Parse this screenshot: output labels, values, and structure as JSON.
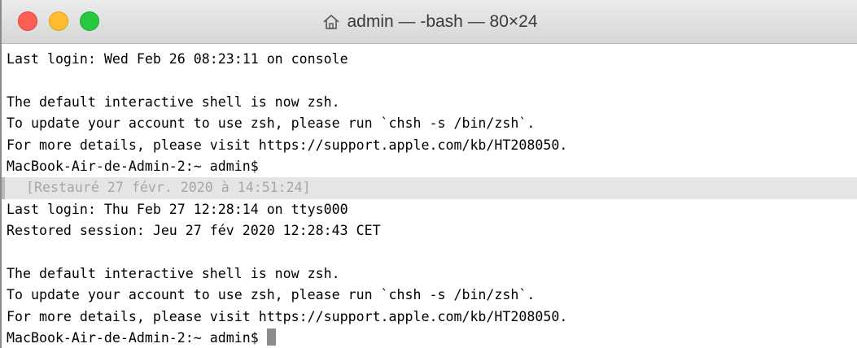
{
  "window": {
    "title": "admin — -bash — 80×24"
  },
  "terminal": {
    "lines": [
      "Last login: Wed Feb 26 08:23:11 on console",
      "",
      "The default interactive shell is now zsh.",
      "To update your account to use zsh, please run `chsh -s /bin/zsh`.",
      "For more details, please visit https://support.apple.com/kb/HT208050.",
      "MacBook-Air-de-Admin-2:~ admin$",
      "[Restauré 27 févr. 2020 à 14:51:24]",
      "Last login: Thu Feb 27 12:28:14 on ttys000",
      "Restored session: Jeu 27 fév 2020 12:28:43 CET",
      "",
      "The default interactive shell is now zsh.",
      "To update your account to use zsh, please run `chsh -s /bin/zsh`.",
      "For more details, please visit https://support.apple.com/kb/HT208050.",
      "MacBook-Air-de-Admin-2:~ admin$ "
    ]
  },
  "colors": {
    "close": "#fd5f57",
    "minimize": "#febc2e",
    "maximize": "#28c840",
    "restore_bar_bg": "#e5e5e5",
    "restore_text": "#a6a6a6"
  }
}
